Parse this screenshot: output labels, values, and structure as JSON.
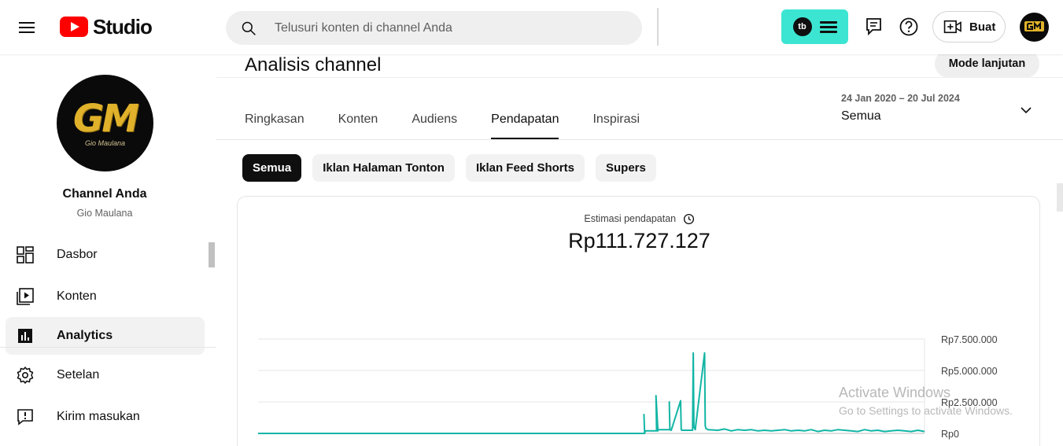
{
  "header": {
    "studio_label": "Studio",
    "search_placeholder": "Telusuri konten di channel Anda",
    "tubebuddy_badge": "tb",
    "create_label": "Buat",
    "icons": {
      "menu": "hamburger-icon",
      "search": "search-icon",
      "feedback": "feedback-icon",
      "help": "help-icon",
      "create": "video-plus-icon"
    },
    "accent_color": "#3ce5d2"
  },
  "sidebar": {
    "avatar_logo": "GM",
    "avatar_subtitle": "Gio Maulana",
    "channel_title": "Channel Anda",
    "channel_name": "Gio Maulana",
    "items": [
      {
        "label": "Dasbor",
        "icon": "dashboard-icon",
        "active": false
      },
      {
        "label": "Konten",
        "icon": "content-icon",
        "active": false
      },
      {
        "label": "Analytics",
        "icon": "analytics-icon",
        "active": true
      },
      {
        "label": "Setelan",
        "icon": "gear-icon",
        "active": false
      },
      {
        "label": "Kirim masukan",
        "icon": "feedback-icon",
        "active": false
      }
    ]
  },
  "main": {
    "title": "Analisis channel",
    "advanced_mode": "Mode lanjutan",
    "tabs": [
      {
        "label": "Ringkasan",
        "active": false
      },
      {
        "label": "Konten",
        "active": false
      },
      {
        "label": "Audiens",
        "active": false
      },
      {
        "label": "Pendapatan",
        "active": true
      },
      {
        "label": "Inspirasi",
        "active": false
      }
    ],
    "date_range": "24 Jan 2020 – 20 Jul 2024",
    "date_value": "Semua",
    "chips": [
      {
        "label": "Semua",
        "active": true
      },
      {
        "label": "Iklan Halaman Tonton",
        "active": false
      },
      {
        "label": "Iklan Feed Shorts",
        "active": false
      },
      {
        "label": "Supers",
        "active": false
      }
    ],
    "metric_label": "Estimasi pendapatan",
    "metric_value": "Rp111.727.127"
  },
  "chart_data": {
    "type": "line",
    "ylim": [
      0,
      7500000
    ],
    "yticks": [
      "Rp7.500.000",
      "Rp5.000.000",
      "Rp2.500.000",
      "Rp0"
    ],
    "ytick_values": [
      7500000,
      5000000,
      2500000,
      0
    ],
    "xlim": [
      0,
      1
    ],
    "grid": true,
    "line_color": "#12b5a5",
    "series": [
      {
        "x": [
          0,
          0.58,
          0.579,
          0.58,
          0.581,
          0.6,
          0.597,
          0.598,
          0.6,
          0.618,
          0.617,
          0.618,
          0.62,
          0.634,
          0.635,
          0.636,
          0.652,
          0.653,
          0.654,
          0.656,
          0.67,
          0.671,
          0.672,
          0.675,
          0.69,
          0.7,
          0.71,
          0.72,
          0.73,
          0.74,
          0.75,
          0.76,
          0.77,
          0.78,
          0.79,
          0.8,
          0.81,
          0.82,
          0.83,
          0.84,
          0.85,
          0.86,
          0.87,
          0.88,
          0.89,
          0.9,
          0.91,
          0.92,
          0.93,
          0.94,
          0.95,
          0.96,
          0.97,
          0.98,
          0.99,
          1.0
        ],
        "y": [
          0,
          0,
          1500000,
          0,
          200000,
          200000,
          3000000,
          200000,
          300000,
          300000,
          2500000,
          300000,
          250000,
          2600000,
          300000,
          250000,
          250000,
          6400000,
          500000,
          300000,
          6400000,
          600000,
          400000,
          300000,
          250000,
          350000,
          200000,
          300000,
          250000,
          300000,
          200000,
          250000,
          200000,
          250000,
          300000,
          200000,
          250000,
          200000,
          300000,
          150000,
          250000,
          200000,
          300000,
          250000,
          200000,
          150000,
          300000,
          200000,
          250000,
          150000,
          200000,
          250000,
          200000,
          150000,
          250000,
          150000
        ]
      }
    ]
  },
  "watermark": {
    "line1": "Activate Windows",
    "line2": "Go to Settings to activate Windows."
  }
}
